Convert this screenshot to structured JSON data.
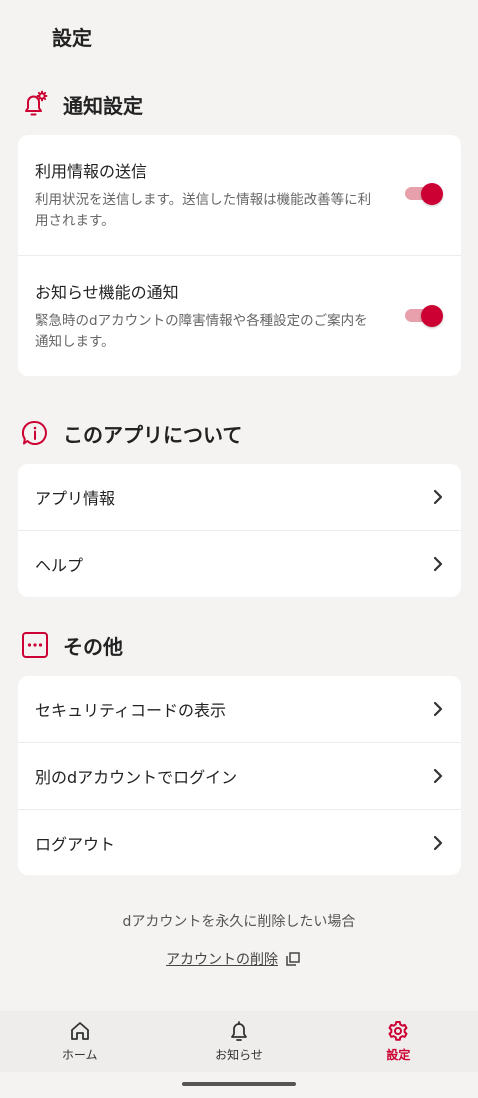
{
  "header": {
    "title": "設定"
  },
  "notification_section": {
    "title": "通知設定",
    "items": [
      {
        "title": "利用情報の送信",
        "description": "利用状況を送信します。送信した情報は機能改善等に利用されます。",
        "enabled": true
      },
      {
        "title": "お知らせ機能の通知",
        "description": "緊急時のdアカウントの障害情報や各種設定のご案内を通知します。",
        "enabled": true
      }
    ]
  },
  "about_section": {
    "title": "このアプリについて",
    "items": [
      {
        "label": "アプリ情報"
      },
      {
        "label": "ヘルプ"
      }
    ]
  },
  "other_section": {
    "title": "その他",
    "items": [
      {
        "label": "セキュリティコードの表示"
      },
      {
        "label": "別のdアカウントでログイン"
      },
      {
        "label": "ログアウト"
      }
    ]
  },
  "delete_account": {
    "note": "dアカウントを永久に削除したい場合",
    "link_label": "アカウントの削除"
  },
  "bottom_nav": {
    "items": [
      {
        "label": "ホーム",
        "icon": "home-icon",
        "active": false
      },
      {
        "label": "お知らせ",
        "icon": "bell-icon",
        "active": false
      },
      {
        "label": "設定",
        "icon": "gear-icon",
        "active": true
      }
    ]
  },
  "colors": {
    "accent": "#cc0033",
    "toggle_track": "#e8a0ac",
    "background": "#f4f3f1",
    "card": "#ffffff"
  }
}
